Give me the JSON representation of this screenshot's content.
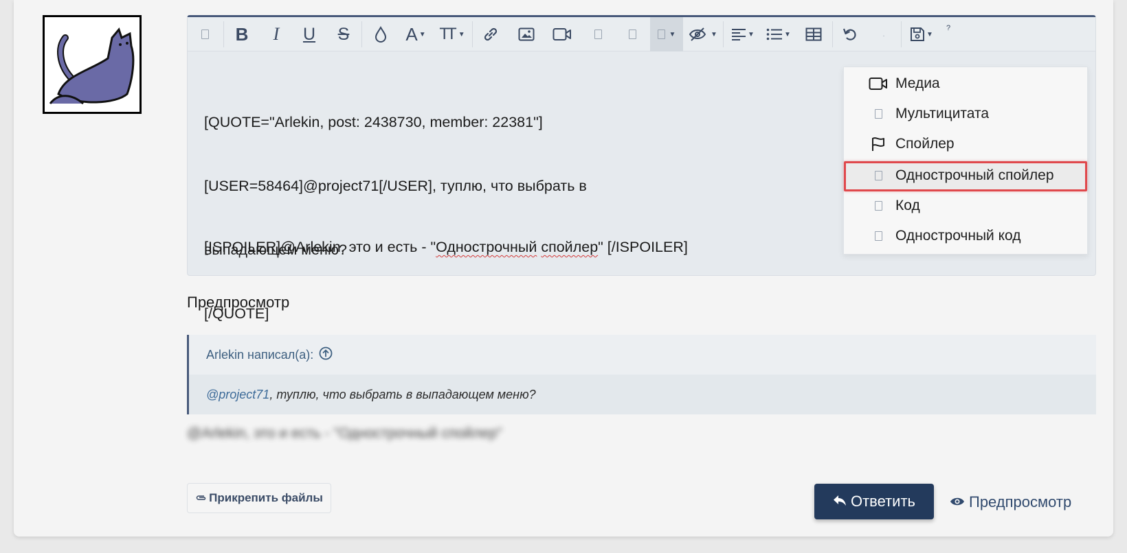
{
  "editor": {
    "content_lines": [
      "[QUOTE=\"Arlekin, post: 2438730, member: 22381\"]",
      "[USER=58464]@project71[/USER], туплю, что выбрать в",
      "выпадающем меню?",
      "[/QUOTE]"
    ],
    "last_line": {
      "prefix": "[ISPOILER]@Arlekin, это и есть - \"",
      "word1": "Однострочный",
      "space": " ",
      "word2": "спойлер",
      "suffix": "\" [/ISPOILER]"
    }
  },
  "dropdown": {
    "items": [
      {
        "label": "Медиа",
        "icon": "video-icon"
      },
      {
        "label": "Мультицитата",
        "icon": "box-icon"
      },
      {
        "label": "Спойлер",
        "icon": "flag-icon"
      },
      {
        "label": "Однострочный спойлер",
        "icon": "box-icon"
      },
      {
        "label": "Код",
        "icon": "box-icon"
      },
      {
        "label": "Однострочный код",
        "icon": "box-icon"
      }
    ],
    "highlighted_index": 3
  },
  "preview": {
    "label": "Предпросмотр",
    "quote_author": "Arlekin написал(а):",
    "quote_mention": "@project71",
    "quote_text": ", туплю, что выбрать в выпадающем меню?",
    "blurred_text": "@Arlekin, это и есть - \"Однострочный спойлер\""
  },
  "actions": {
    "attach_label": "Прикрепить файлы",
    "reply_label": "Ответить",
    "preview_label": "Предпросмотр"
  },
  "toolbar": {
    "bold": "B",
    "italic": "I",
    "underline": "U",
    "strike": "S",
    "font": "A",
    "size": "TT",
    "help_mark": "?"
  },
  "colors": {
    "accent": "#47597a",
    "button": "#233a5c",
    "highlight_border": "#e0484c",
    "link": "#3d6b99"
  }
}
